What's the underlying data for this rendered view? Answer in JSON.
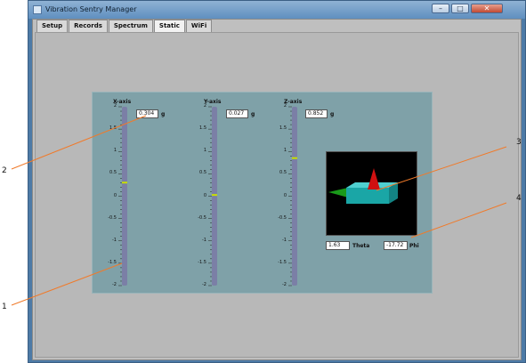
{
  "window": {
    "title": "Vibration Sentry Manager",
    "minimize": "–",
    "maximize": "□",
    "close": "✕"
  },
  "tabs": [
    {
      "label": "Setup",
      "active": false
    },
    {
      "label": "Records",
      "active": false
    },
    {
      "label": "Spectrum",
      "active": false
    },
    {
      "label": "Static",
      "active": true
    },
    {
      "label": "WiFi",
      "active": false
    }
  ],
  "axes": [
    {
      "label": "X-axis",
      "value": "0.304",
      "level": 0.304
    },
    {
      "label": "Y-axis",
      "value": "0.027",
      "level": 0.027
    },
    {
      "label": "Z-axis",
      "value": "0.852",
      "level": 0.852
    }
  ],
  "unit": "g",
  "scale": {
    "ticks": [
      "2",
      "1.5",
      "1",
      "0.5",
      "0",
      "-0.5",
      "-1",
      "-1.5",
      "-2"
    ],
    "min": -2,
    "max": 2
  },
  "orientation": {
    "theta_value": "1.63",
    "theta_label": "Theta",
    "phi_value": "-17.72",
    "phi_label": "Phi"
  },
  "callouts": [
    "1",
    "2",
    "3",
    "4"
  ],
  "colors": {
    "panel": "#7fa1a8",
    "slider_track": "#7b7fa6",
    "slider_marker": "#c8e000",
    "callout_line": "#f07a2a",
    "box": "#1aa6a6",
    "cone": "#d01010",
    "arrow": "#1a9a1a"
  }
}
